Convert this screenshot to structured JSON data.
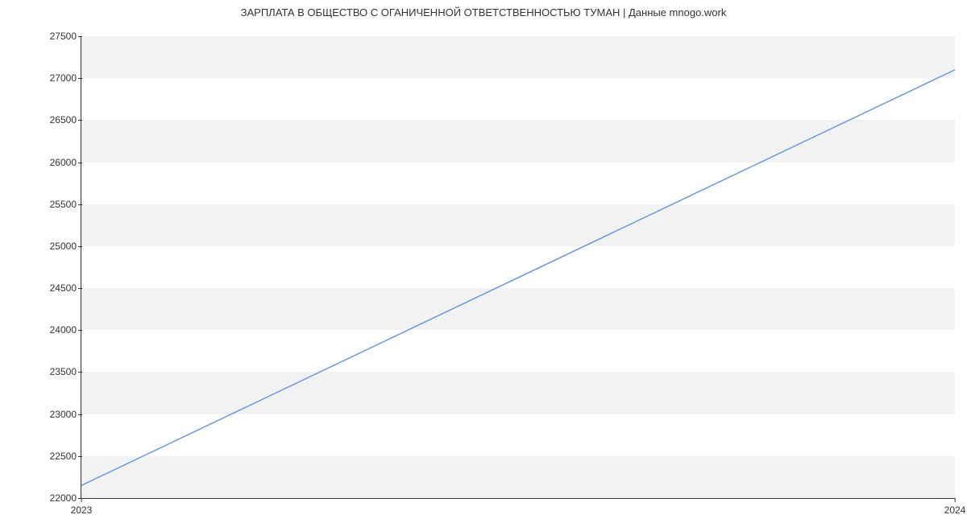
{
  "chart_data": {
    "type": "line",
    "title": "ЗАРПЛАТА В ОБЩЕСТВО С ОГАНИЧЕННОЙ ОТВЕТСТВЕННОСТЬЮ ТУМАН | Данные mnogo.work",
    "xlabel": "",
    "ylabel": "",
    "x": [
      2023,
      2024
    ],
    "values": [
      22150,
      27100
    ],
    "y_ticks": [
      22000,
      22500,
      23000,
      23500,
      24000,
      24500,
      25000,
      25500,
      26000,
      26500,
      27000,
      27500
    ],
    "x_ticks": [
      2023,
      2024
    ],
    "ylim": [
      22000,
      27500
    ],
    "xlim": [
      2023,
      2024
    ],
    "line_color": "#6699e0"
  }
}
